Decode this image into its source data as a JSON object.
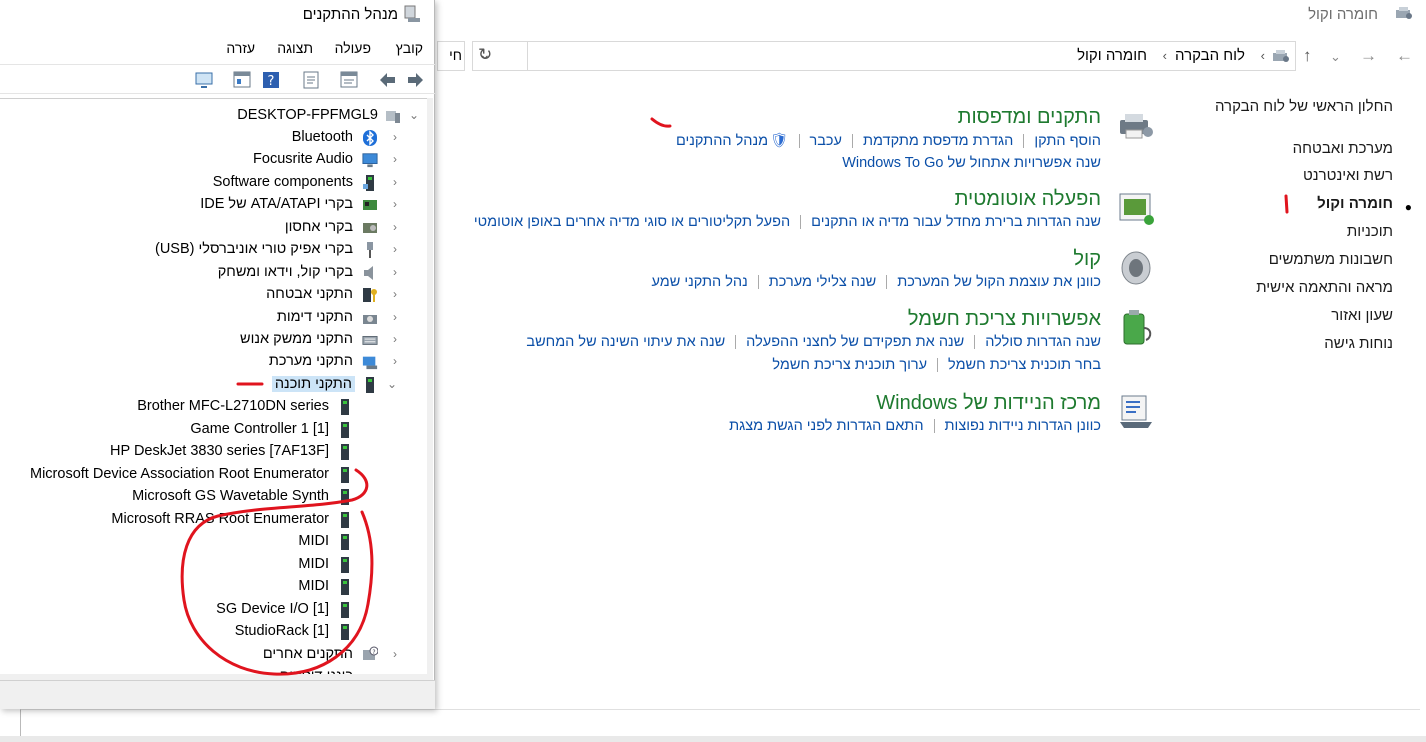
{
  "control_panel": {
    "title": "חומרה וקול",
    "address": {
      "root": "לוח הבקרה",
      "current": "חומרה וקול",
      "search_partial": "חי"
    },
    "sidebar": {
      "items": [
        {
          "label": "החלון הראשי של לוח הבקרה"
        },
        {
          "label": "מערכת ואבטחה"
        },
        {
          "label": "רשת ואינטרנט"
        },
        {
          "label": "חומרה וקול"
        },
        {
          "label": "תוכניות"
        },
        {
          "label": "חשבונות משתמשים"
        },
        {
          "label": "מראה והתאמה אישית"
        },
        {
          "label": "שעון ואזור"
        },
        {
          "label": "נוחות גישה"
        }
      ]
    },
    "categories": {
      "devices": {
        "title": "התקנים ומדפסות",
        "links": [
          "הוסף התקן",
          "הגדרת מדפסת מתקדמת",
          "עכבר",
          "מנהל ההתקנים"
        ],
        "links2": [
          "שנה אפשרויות אתחול של Windows To Go"
        ]
      },
      "autoplay": {
        "title": "הפעלה אוטומטית",
        "links": [
          "שנה הגדרות ברירת מחדל עבור מדיה או התקנים",
          "הפעל תקליטורים או סוגי מדיה אחרים באופן אוטומטי"
        ]
      },
      "sound": {
        "title": "קול",
        "links": [
          "כוונן את עוצמת הקול של המערכת",
          "שנה צלילי מערכת",
          "נהל התקני שמע"
        ]
      },
      "power": {
        "title": "אפשרויות צריכת חשמל",
        "links": [
          "שנה הגדרות סוללה",
          "שנה את תפקידם של לחצני ההפעלה",
          "שנה את עיתוי השינה של המחשב"
        ],
        "links2": [
          "בחר תוכנית צריכת חשמל",
          "ערוך תוכנית צריכת חשמל"
        ]
      },
      "mobility": {
        "title": "מרכז הניידות של Windows",
        "links": [
          "כוונן הגדרות ניידות נפוצות",
          "התאם הגדרות לפני הגשת מצגת"
        ]
      }
    }
  },
  "device_manager": {
    "title": "מנהל ההתקנים",
    "menu": [
      "קובץ",
      "פעולה",
      "תצוגה",
      "עזרה"
    ],
    "tree": {
      "root": "DESKTOP-FPFMGL9",
      "categories": [
        "Bluetooth",
        "Focusrite Audio",
        "Software components",
        "בקרי ATA/ATAPI של IDE",
        "בקרי אחסון",
        "בקרי אפיק טורי אוניברסלי (USB)",
        "בקרי קול, וידאו ומשחק",
        "התקני אבטחה",
        "התקני דימות",
        "התקני ממשק אנוש",
        "התקני מערכת",
        "התקני תוכנה"
      ],
      "software_devices": [
        "Brother MFC-L2710DN series",
        "Game Controller 1 [1]",
        "HP DeskJet 3830 series [7AF13F]",
        "Microsoft Device Association Root Enumerator",
        "Microsoft GS Wavetable Synth",
        "Microsoft RRAS Root Enumerator",
        "MIDI",
        "MIDI",
        "MIDI",
        "SG Device I/O [1]",
        "StudioRack [1]"
      ],
      "after": [
        "התקנים אחרים",
        "כונני דיסקים"
      ]
    }
  },
  "colors": {
    "link": "#0b4fa8",
    "category_title": "#1e7a2f",
    "annotation": "#e0141e",
    "selection": "#cce4f7"
  }
}
